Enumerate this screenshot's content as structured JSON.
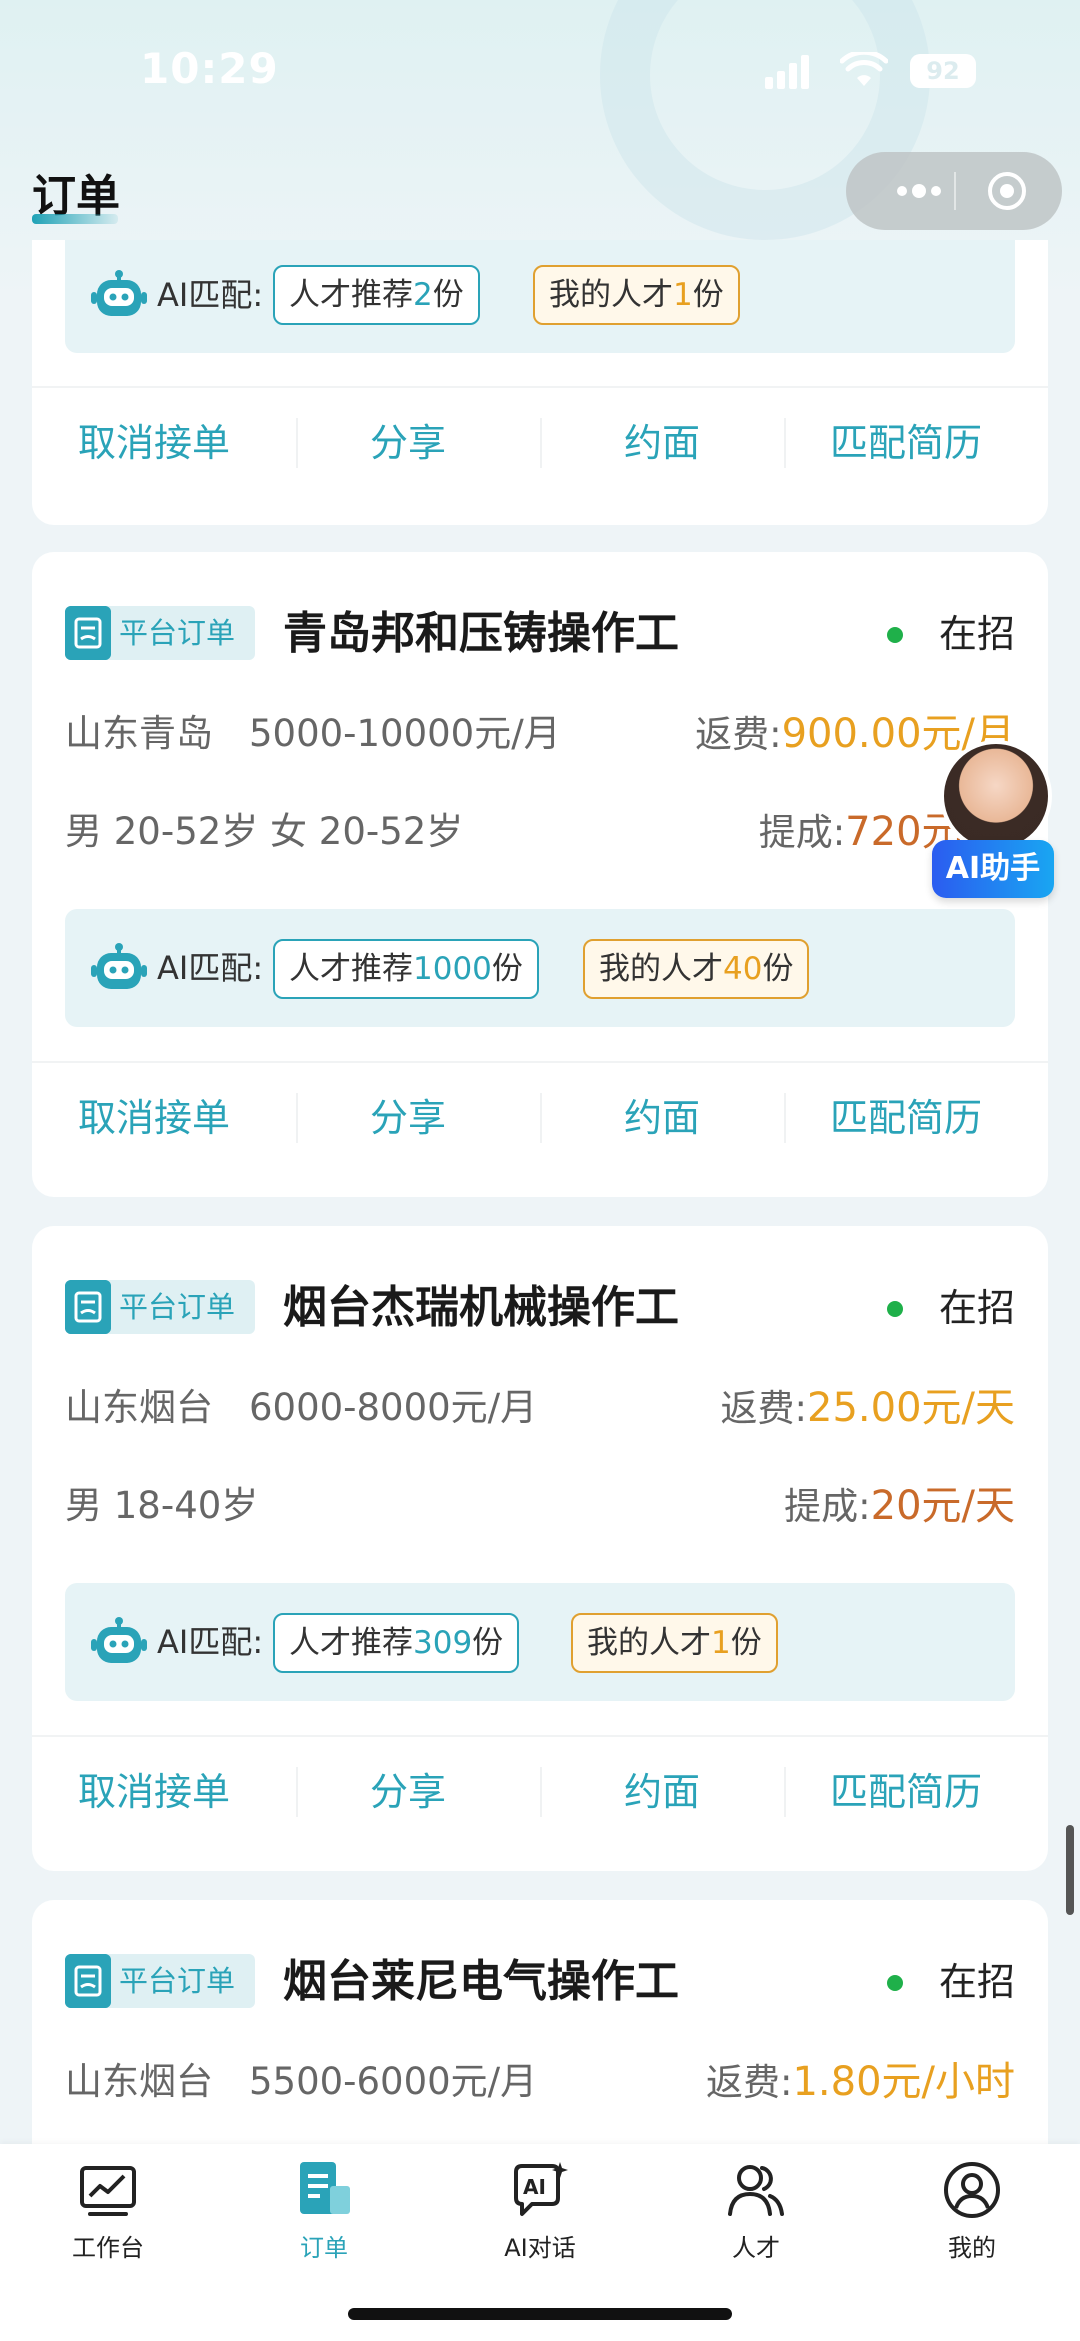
{
  "status_bar": {
    "time": "10:29",
    "battery": "92"
  },
  "header": {
    "title": "订单"
  },
  "partial_card": {
    "ai": {
      "label": "AI匹配:",
      "talent_prefix": "人才推荐",
      "talent_count": "2",
      "talent_suffix": "份",
      "mine_prefix": "我的人才",
      "mine_count": "1",
      "mine_suffix": "份"
    },
    "actions": [
      "取消接单",
      "分享",
      "约面",
      "匹配简历"
    ]
  },
  "cards": [
    {
      "badge": "平台订单",
      "title": "青岛邦和压铸操作工",
      "status": "在招",
      "location": "山东青岛",
      "salary": "5000-10000元/月",
      "fee_label": "返费:",
      "fee_value": "900.00元/月",
      "requirement": "男 20-52岁 女 20-52岁",
      "commission_label": "提成:",
      "commission_value": "720元/月",
      "ai": {
        "label": "AI匹配:",
        "talent_prefix": "人才推荐",
        "talent_count": "1000",
        "talent_suffix": "份",
        "mine_prefix": "我的人才",
        "mine_count": "40",
        "mine_suffix": "份"
      },
      "actions": [
        "取消接单",
        "分享",
        "约面",
        "匹配简历"
      ]
    },
    {
      "badge": "平台订单",
      "title": "烟台杰瑞机械操作工",
      "status": "在招",
      "location": "山东烟台",
      "salary": "6000-8000元/月",
      "fee_label": "返费:",
      "fee_value": "25.00元/天",
      "requirement": "男 18-40岁",
      "commission_label": "提成:",
      "commission_value": "20元/天",
      "ai": {
        "label": "AI匹配:",
        "talent_prefix": "人才推荐",
        "talent_count": "309",
        "talent_suffix": "份",
        "mine_prefix": "我的人才",
        "mine_count": "1",
        "mine_suffix": "份"
      },
      "actions": [
        "取消接单",
        "分享",
        "约面",
        "匹配简历"
      ]
    },
    {
      "badge": "平台订单",
      "title": "烟台莱尼电气操作工",
      "status": "在招",
      "location": "山东烟台",
      "salary": "5500-6000元/月",
      "fee_label": "返费:",
      "fee_value": "1.80元/小时"
    }
  ],
  "ai_assistant": {
    "label": "AI助手"
  },
  "tab_bar": [
    {
      "label": "工作台",
      "icon": "chart-monitor-icon",
      "active": false
    },
    {
      "label": "订单",
      "icon": "order-list-icon",
      "active": true
    },
    {
      "label": "AI对话",
      "icon": "ai-chat-icon",
      "active": false
    },
    {
      "label": "人才",
      "icon": "people-icon",
      "active": false
    },
    {
      "label": "我的",
      "icon": "profile-icon",
      "active": false
    }
  ],
  "colors": {
    "accent": "#2aa3b8",
    "fee": "#e8a020",
    "commission": "#c96a2a",
    "status_dot": "#1fb04a"
  }
}
